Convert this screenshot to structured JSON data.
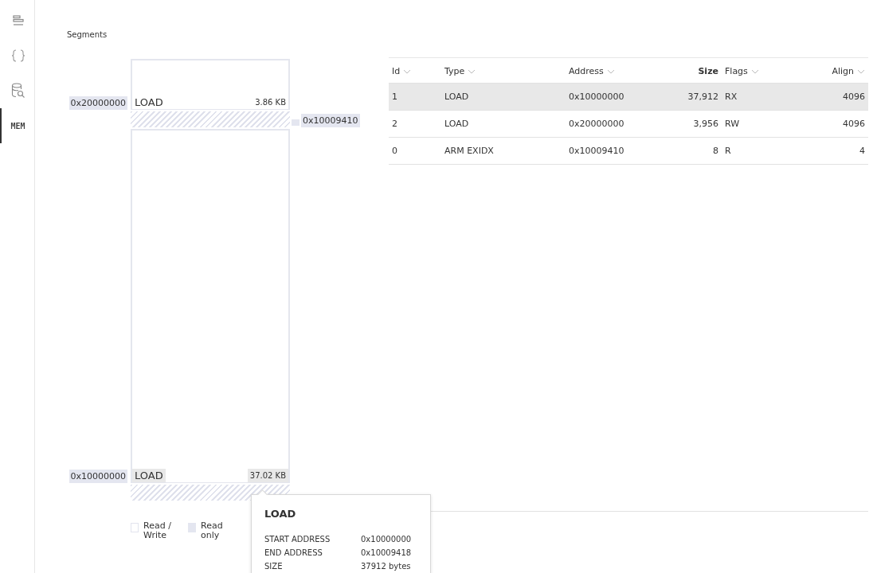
{
  "sidebar": {
    "items": [
      {
        "kind": "outline",
        "selected": false
      },
      {
        "kind": "braces",
        "selected": false
      },
      {
        "kind": "db-search",
        "selected": false
      },
      {
        "kind": "text",
        "label": "MEM",
        "selected": true
      }
    ]
  },
  "section_title": "Segments",
  "memory_map": [
    {
      "kind": "segment",
      "name": "LOAD",
      "size": "3.86 KB",
      "address": "0x20000000",
      "hovered": false
    },
    {
      "kind": "gap",
      "marker": "0x10009410"
    },
    {
      "kind": "segment",
      "name": "LOAD",
      "size": "37.02 KB",
      "address": "0x10000000",
      "hovered": true
    },
    {
      "kind": "gap"
    }
  ],
  "legend": [
    {
      "label": "Read / Write",
      "kind": "rw"
    },
    {
      "label": "Read only",
      "kind": "ro"
    }
  ],
  "table": {
    "columns": [
      {
        "label": "Id",
        "sorted": false,
        "kind": "text"
      },
      {
        "label": "Type",
        "sorted": false,
        "kind": "text"
      },
      {
        "label": "Address",
        "sorted": false,
        "kind": "text"
      },
      {
        "label": "Size",
        "sorted": true,
        "kind": "numeric"
      },
      {
        "label": "Flags",
        "sorted": false,
        "kind": "text"
      },
      {
        "label": "Align",
        "sorted": false,
        "kind": "numeric"
      }
    ],
    "rows": [
      {
        "selected": true,
        "cells": [
          "1",
          "LOAD",
          "0x10000000",
          "37,912",
          "RX",
          "4096"
        ]
      },
      {
        "selected": false,
        "cells": [
          "2",
          "LOAD",
          "0x20000000",
          "3,956",
          "RW",
          "4096"
        ]
      },
      {
        "selected": false,
        "cells": [
          "0",
          "ARM EXIDX",
          "0x10009410",
          "8",
          "R",
          "4"
        ]
      }
    ]
  },
  "tooltip": {
    "title": "LOAD",
    "rows": [
      {
        "label": "START ADDRESS",
        "value": "0x10000000"
      },
      {
        "label": "END ADDRESS",
        "value": "0x10009418"
      },
      {
        "label": "SIZE",
        "value": "37912 bytes"
      }
    ]
  }
}
